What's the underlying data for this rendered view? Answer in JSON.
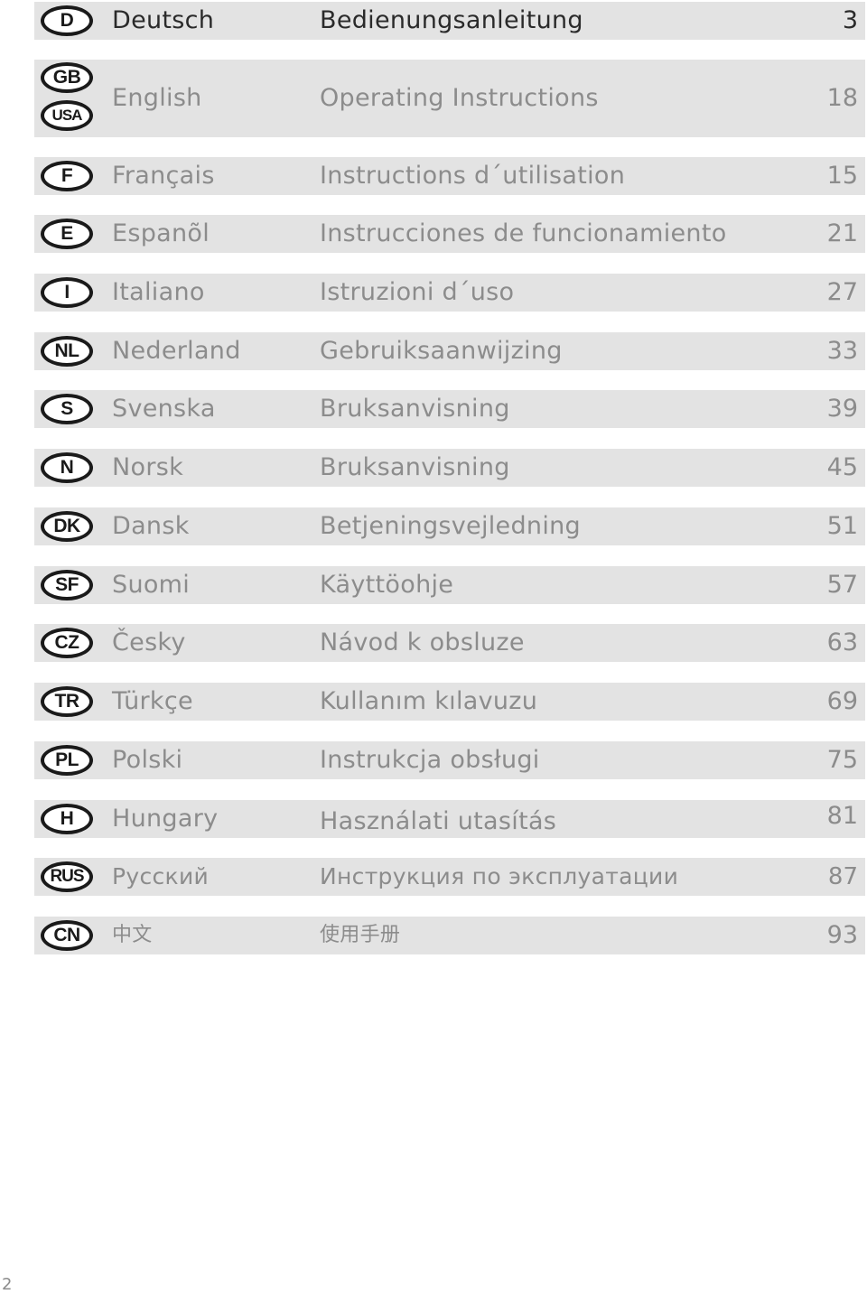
{
  "toc": {
    "entries": [
      {
        "codes": [
          "D"
        ],
        "language": "Deutsch",
        "title": "Bedienungsanleitung",
        "page": "3",
        "highlighted": true
      },
      {
        "codes": [
          "GB",
          "USA"
        ],
        "language": "English",
        "title": "Operating Instructions",
        "page": "18",
        "highlighted": false
      },
      {
        "codes": [
          "F"
        ],
        "language": "Français",
        "title": "Instructions d´utilisation",
        "page": "15",
        "highlighted": false
      },
      {
        "codes": [
          "E"
        ],
        "language": "Espanõl",
        "title": "Instrucciones de funcionamiento",
        "page": "21",
        "highlighted": false
      },
      {
        "codes": [
          "I"
        ],
        "language": "Italiano",
        "title": "Istruzioni d´uso",
        "page": "27",
        "highlighted": false
      },
      {
        "codes": [
          "NL"
        ],
        "language": "Nederland",
        "title": "Gebruiksaanwijzing",
        "page": "33",
        "highlighted": false
      },
      {
        "codes": [
          "S"
        ],
        "language": "Svenska",
        "title": "Bruksanvisning",
        "page": "39",
        "highlighted": false
      },
      {
        "codes": [
          "N"
        ],
        "language": "Norsk",
        "title": "Bruksanvisning",
        "page": "45",
        "highlighted": false
      },
      {
        "codes": [
          "DK"
        ],
        "language": "Dansk",
        "title": "Betjeningsvejledning",
        "page": "51",
        "highlighted": false
      },
      {
        "codes": [
          "SF"
        ],
        "language": "Suomi",
        "title": "Käyttöohje",
        "page": "57",
        "highlighted": false
      },
      {
        "codes": [
          "CZ"
        ],
        "language": "Česky",
        "title": "Návod k obsluze",
        "page": "63",
        "highlighted": false
      },
      {
        "codes": [
          "TR"
        ],
        "language": "Türkçe",
        "title": "Kullanım kılavuzu",
        "page": "69",
        "highlighted": false
      },
      {
        "codes": [
          "PL"
        ],
        "language": "Polski",
        "title": "Instrukcja obsługi",
        "page": "75",
        "highlighted": false
      },
      {
        "codes": [
          "H"
        ],
        "language": "Hungary",
        "title": "Használati utasítás",
        "page": "81",
        "highlighted": false
      },
      {
        "codes": [
          "RUS"
        ],
        "language": "Русский",
        "title": "Инструкция по эксплуатации",
        "page": "87",
        "highlighted": false
      },
      {
        "codes": [
          "CN"
        ],
        "language": "中文",
        "title": "使用手册",
        "page": "93",
        "highlighted": false
      }
    ]
  },
  "footer": {
    "page_number": "2"
  },
  "colors": {
    "row_background": "#e3e3e3",
    "text_muted": "#8c8c8c",
    "text_active": "#2a2a2a",
    "badge_border": "#1a1a1a"
  }
}
